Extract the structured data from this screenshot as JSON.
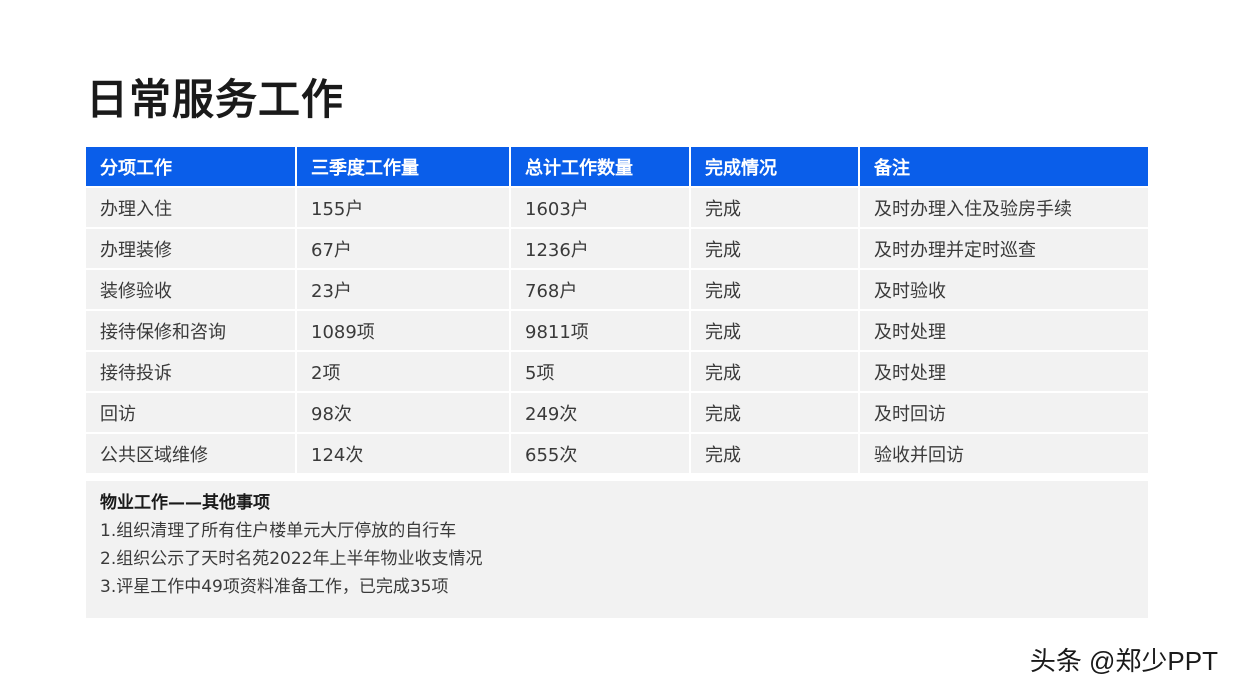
{
  "title": "日常服务工作",
  "table": {
    "headers": [
      "分项工作",
      "三季度工作量",
      "总计工作数量",
      "完成情况",
      "备注"
    ],
    "rows": [
      [
        "办理入住",
        "155户",
        "1603户",
        "完成",
        "及时办理入住及验房手续"
      ],
      [
        "办理装修",
        "67户",
        "1236户",
        "完成",
        "及时办理并定时巡查"
      ],
      [
        "装修验收",
        "23户",
        "768户",
        "完成",
        "及时验收"
      ],
      [
        "接待保修和咨询",
        "1089项",
        "9811项",
        "完成",
        "及时处理"
      ],
      [
        "接待投诉",
        "2项",
        "5项",
        "完成",
        "及时处理"
      ],
      [
        "回访",
        "98次",
        "249次",
        "完成",
        "及时回访"
      ],
      [
        "公共区域维修",
        "124次",
        "655次",
        "完成",
        "验收并回访"
      ]
    ]
  },
  "notes": {
    "title": "物业工作——其他事项",
    "items": [
      "1.组织清理了所有住户楼单元大厅停放的自行车",
      "2.组织公示了天时名苑2022年上半年物业收支情况",
      "3.评星工作中49项资料准备工作，已完成35项"
    ]
  },
  "watermark": "头条 @郑少PPT",
  "colors": {
    "header_bg": "#0a5eea",
    "cell_bg": "#f2f2f2",
    "title": "#1a1a1a"
  }
}
